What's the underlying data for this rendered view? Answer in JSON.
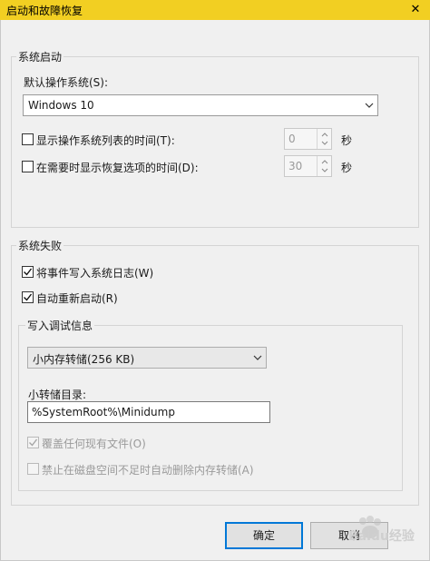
{
  "window": {
    "title": "启动和故障恢复",
    "close_glyph": "✕"
  },
  "system_startup": {
    "group_label": "系统启动",
    "default_os_label": "默认操作系统(S):",
    "default_os_value": "Windows 10",
    "show_list_label": "显示操作系统列表的时间(T):",
    "show_list_checked": false,
    "show_list_value": "0",
    "show_recovery_label": "在需要时显示恢复选项的时间(D):",
    "show_recovery_checked": false,
    "show_recovery_value": "30",
    "seconds_unit": "秒"
  },
  "system_failure": {
    "group_label": "系统失败",
    "write_event_label": "将事件写入系统日志(W)",
    "write_event_checked": true,
    "auto_restart_label": "自动重新启动(R)",
    "auto_restart_checked": true,
    "debug_info": {
      "group_label": "写入调试信息",
      "dump_type_value": "小内存转储(256 KB)",
      "dump_dir_label": "小转储目录:",
      "dump_dir_value": "%SystemRoot%\\Minidump",
      "overwrite_label": "覆盖任何现有文件(O)",
      "overwrite_checked": true,
      "overwrite_enabled": false,
      "disable_auto_delete_label": "禁止在磁盘空间不足时自动删除内存转储(A)",
      "disable_auto_delete_checked": false,
      "disable_auto_delete_enabled": false
    }
  },
  "buttons": {
    "ok_label": "确定",
    "cancel_label": "取消"
  },
  "watermark": {
    "text": "Baidu经验"
  },
  "colors": {
    "titlebar": "#f2cf22",
    "focus": "#0078d7"
  }
}
